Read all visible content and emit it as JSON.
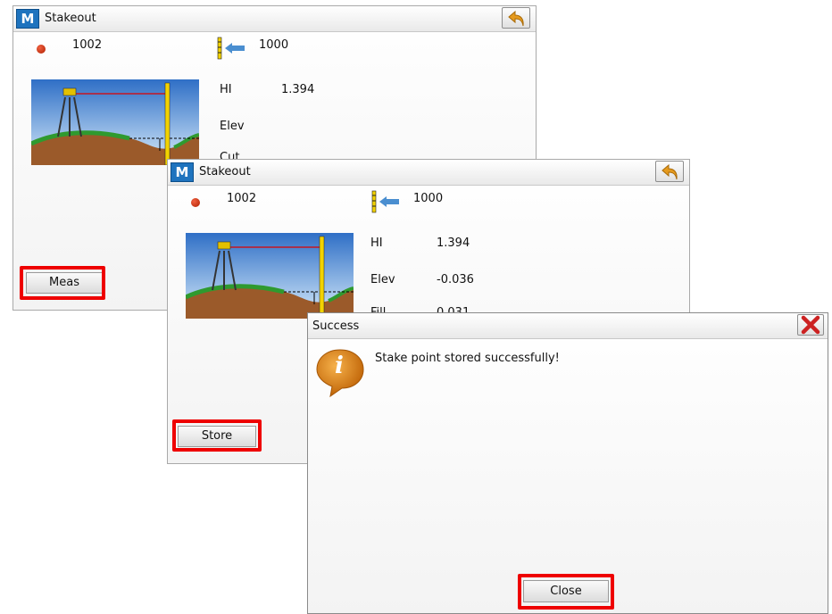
{
  "app_logo_letter": "M",
  "window1": {
    "title": "Stakeout",
    "point_from": "1002",
    "point_to": "1000",
    "hi_label": "HI",
    "hi_value": "1.394",
    "elev_label": "Elev",
    "cut_label": "Cut",
    "button_label": "Meas"
  },
  "window2": {
    "title": "Stakeout",
    "point_from": "1002",
    "point_to": "1000",
    "hi_label": "HI",
    "hi_value": "1.394",
    "elev_label": "Elev",
    "elev_value": "-0.036",
    "fill_label": "Fill",
    "fill_value": "0.031",
    "button_label": "Store"
  },
  "dialog": {
    "title": "Success",
    "message": "Stake point stored successfully!",
    "close_label": "Close",
    "info_icon_letter": "i"
  },
  "colors": {
    "highlight": "#ee0000",
    "logo_blue": "#1e73be",
    "back_arrow": "#e59a1e",
    "close_x": "#cc2222"
  }
}
